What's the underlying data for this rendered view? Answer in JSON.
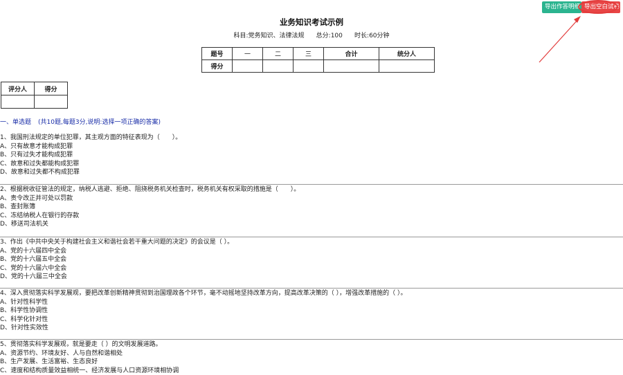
{
  "toolbar": {
    "export_answer_label": "导出作答明细",
    "export_blank_label": "导出空白试卷"
  },
  "exam": {
    "title": "业务知识考试示例",
    "subject_label": "科目:党务知识、法律法规",
    "total_label": "总分:100",
    "duration_label": "时长:60分钟"
  },
  "score_table": {
    "row1": [
      "题号",
      "一",
      "二",
      "三",
      "合计",
      "统分人"
    ],
    "row2": [
      "得分",
      "",
      "",
      "",
      "",
      ""
    ]
  },
  "grader_table": {
    "headers": [
      "评分人",
      "得分"
    ],
    "values": [
      "",
      ""
    ]
  },
  "section": {
    "title": "一、单选题",
    "note": "(共10题,每题3分,说明:选择一项正确的答案)"
  },
  "questions": [
    {
      "text": "1、我国刑法规定的单位犯罪，其主观方面的特征表现为（　　）。",
      "options": [
        "A、只有故意才能构成犯罪",
        "B、只有过失才能构成犯罪",
        "C、故意和过失都能构成犯罪",
        "D、故意和过失都不构成犯罪"
      ]
    },
    {
      "text": "2、根据税收征管法的规定，纳税人逃避、拒绝、阻挠税务机关检查时，税务机关有权采取的措施是（　　）。",
      "options": [
        "A、责令改正并可处以罚款",
        "B、查封账簿",
        "C、冻结纳税人在银行的存款",
        "D、移送司法机关"
      ]
    },
    {
      "text": "3、作出《中共中央关于构建社会主义和谐社会若干重大问题的决定》的会议是（ ）。",
      "options": [
        "A、党的十六届四中全会",
        "B、党的十六届五中全会",
        "C、党的十六届六中全会",
        "D、党的十六届三中全会"
      ]
    },
    {
      "text": "4、深入贯彻落实科学发展观，要把改革创新精神贯彻到治国理政各个环节，毫不动摇地坚持改革方向，提高改革决策的（ ），增强改革措施的（ ）。",
      "options": [
        "A、针对性科学性",
        "B、科学性协调性",
        "C、科学化针对性",
        "D、针对性实效性"
      ]
    },
    {
      "text": "5、贯彻落实科学发展观，就是要走（ ）的文明发展道路。",
      "options": [
        "A、资源节约、环境友好、人与自然和谐相处",
        "B、生产发展、生活富裕、生态良好",
        "C、速度和结构质量效益相统一、经济发展与人口资源环境相协调"
      ]
    }
  ]
}
